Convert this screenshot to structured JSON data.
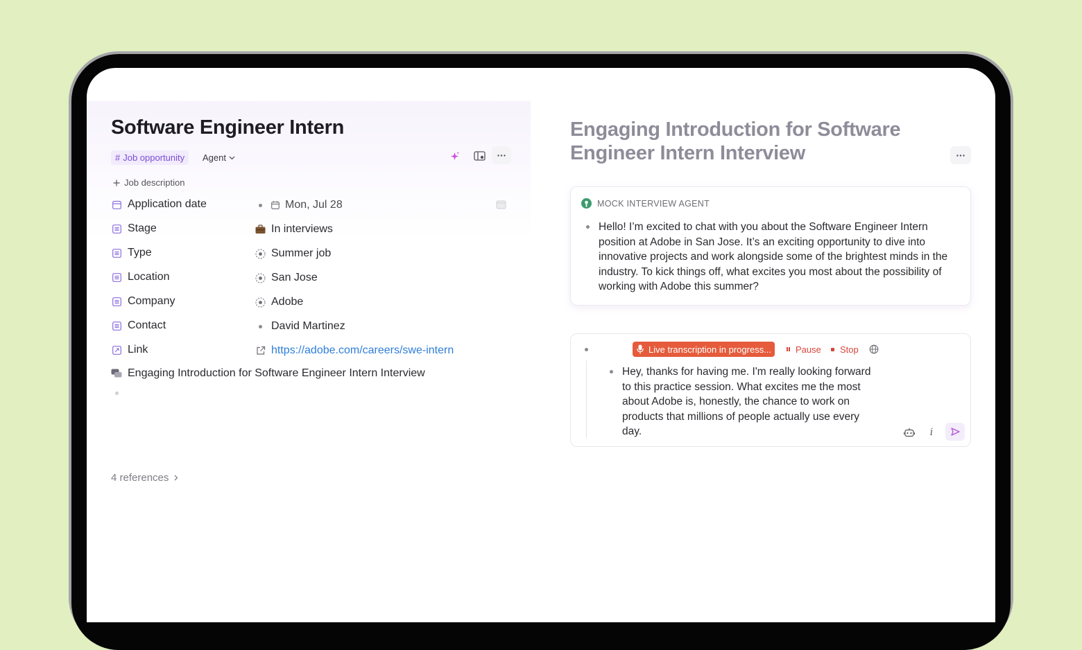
{
  "page": {
    "title": "Software Engineer Intern",
    "tag": "Job opportunity",
    "tag_prefix": "#",
    "agent_label": "Agent",
    "add_description_label": "Job description"
  },
  "properties": [
    {
      "label": "Application date",
      "value": "Mon, Jul 28",
      "icon": "calendar-icon"
    },
    {
      "label": "Stage",
      "value": "In interviews",
      "icon": "briefcase-icon"
    },
    {
      "label": "Type",
      "value": "Summer job",
      "icon": "select-icon"
    },
    {
      "label": "Location",
      "value": "San Jose",
      "icon": "select-icon"
    },
    {
      "label": "Company",
      "value": "Adobe",
      "icon": "select-icon"
    },
    {
      "label": "Contact",
      "value": "David Martinez",
      "icon": "bullet-icon"
    },
    {
      "label": "Link",
      "value": "https://adobe.com/careers/swe-intern",
      "icon": "external-link-icon"
    }
  ],
  "linked_page": "Engaging Introduction for Software Engineer Intern Interview",
  "references": "4 references",
  "right_panel": {
    "title": "Engaging Introduction for Software Engineer Intern Interview",
    "agent_name": "MOCK INTERVIEW AGENT",
    "agent_message": "Hello! I’m excited to chat with you about the Software Engineer Intern position at Adobe in San Jose. It’s an exciting opportunity to dive into innovative projects and work alongside some of the brightest minds in the industry. To kick things off, what excites you most about the possibility of working with Adobe this summer?",
    "transcription_status": "Live transcription in progress...",
    "pause_label": "Pause",
    "stop_label": "Stop",
    "user_message": "Hey, thanks for having me. I'm really looking forward to this practice session. What excites me the most about Adobe is, honestly, the chance to work on products that millions of people actually use every day."
  },
  "colors": {
    "background": "#e1efc1",
    "accent_purple": "#7b4dd6",
    "recording_red": "#e55b3c",
    "link_blue": "#2f7ed8",
    "agent_green": "#3c9b6e"
  }
}
